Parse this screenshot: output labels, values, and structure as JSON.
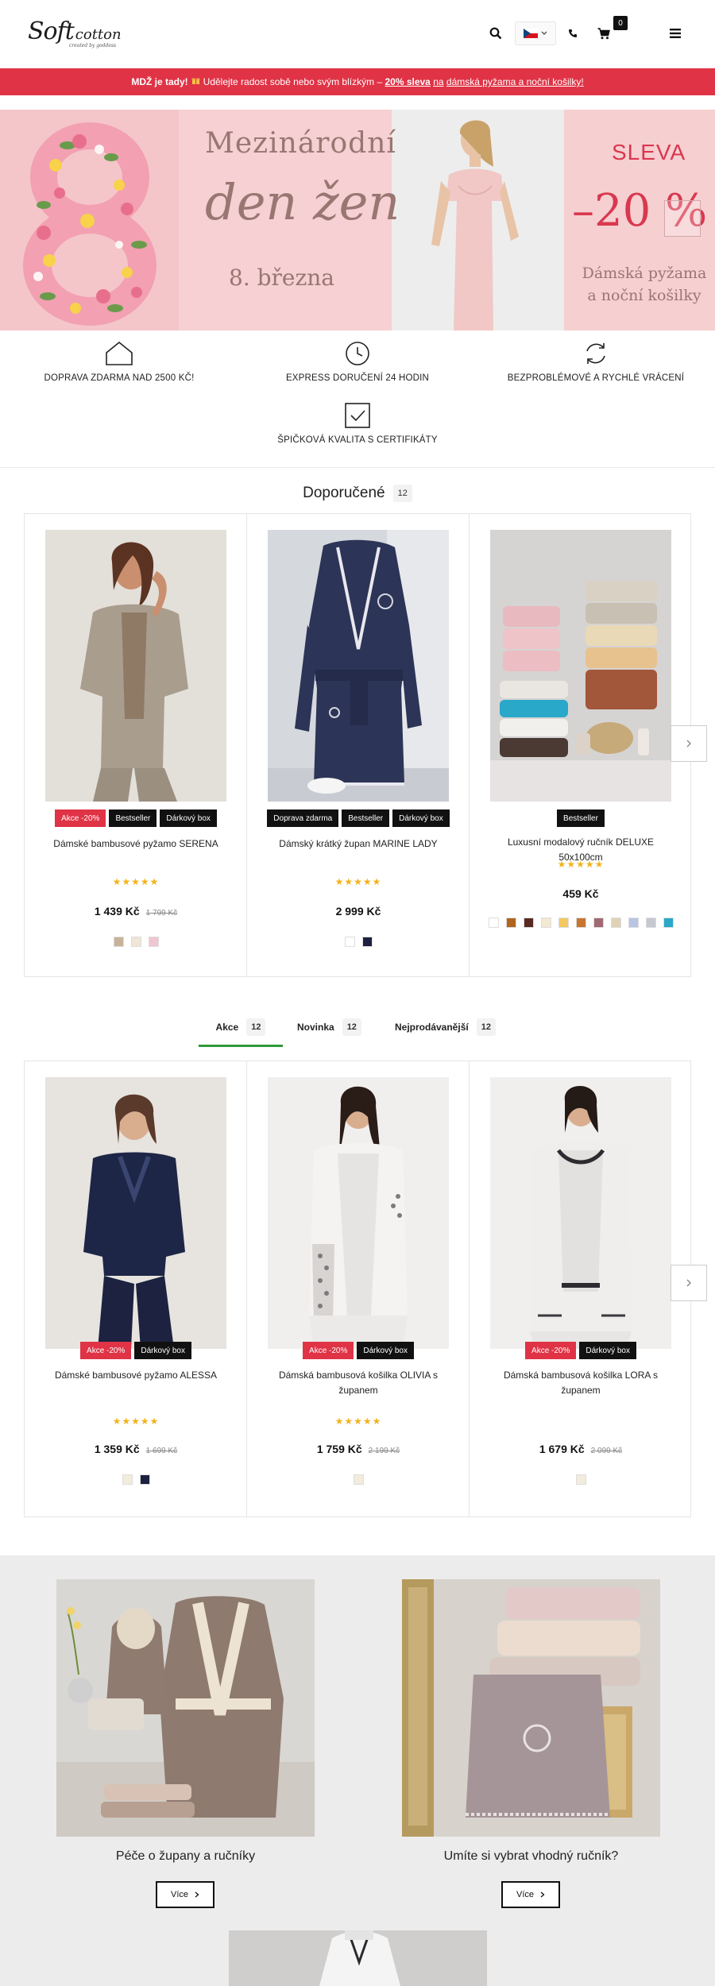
{
  "header": {
    "logo_main": "Soft",
    "logo_second": "cotton",
    "logo_tagline": "created by goddess",
    "cart_count": "0",
    "language": "CZ"
  },
  "promo": {
    "part1": "MDŽ je tady!",
    "part2": "Udělejte radost sobě nebo svým blízkým –",
    "link1": "20% sleva",
    "part3": "na",
    "link2": "dámská pyžama a noční košilky!"
  },
  "hero": {
    "line1": "Mezinárodní",
    "line2": "den žen",
    "line3": "8. března",
    "sale_label": "SLEVA",
    "sale_value": "–20 %",
    "sale_desc1": "Dámská pyžama",
    "sale_desc2": "a noční košilky"
  },
  "features": [
    {
      "label": "DOPRAVA ZDARMA NAD 2500 KČ!",
      "icon": "house-icon"
    },
    {
      "label": "EXPRESS DORUČENÍ 24 HODIN",
      "icon": "clock-icon"
    },
    {
      "label": "BEZPROBLÉMOVÉ A RYCHLÉ VRÁCENÍ",
      "icon": "refresh-icon"
    },
    {
      "label": "ŠPIČKOVÁ KVALITA S CERTIFIKÁTY",
      "icon": "checkbox-icon"
    }
  ],
  "recommended": {
    "title": "Doporučené",
    "count": "12",
    "products": [
      {
        "badges": [
          {
            "text": "Akce -20%",
            "type": "sale"
          },
          {
            "text": "Bestseller",
            "type": "dark"
          },
          {
            "text": "Dárkový box",
            "type": "dark"
          }
        ],
        "name": "Dámské bambusové pyžamo SERENA",
        "stars": "★★★★★",
        "price": "1 439 Kč",
        "old_price": "1 799 Kč",
        "swatches": [
          "#c9b29a",
          "#efe6d8",
          "#efc6d2"
        ]
      },
      {
        "badges": [
          {
            "text": "Doprava zdarma",
            "type": "dark"
          },
          {
            "text": "Bestseller",
            "type": "dark"
          },
          {
            "text": "Dárkový box",
            "type": "dark"
          }
        ],
        "name": "Dámský krátký župan MARINE LADY",
        "stars": "★★★★★",
        "price": "2 999 Kč",
        "old_price": "",
        "swatches": [
          "#ffffff",
          "#1c2140"
        ]
      },
      {
        "badges": [
          {
            "text": "Bestseller",
            "type": "dark"
          }
        ],
        "name": "Luxusní modalový ručník DELUXE 50x100cm",
        "stars": "★★★★★",
        "price": "459 Kč",
        "old_price": "",
        "swatches": [
          "#ffffff",
          "#b0651f",
          "#5a2a22",
          "#f3e9d2",
          "#f4c861",
          "#c6762f",
          "#9f6a72",
          "#e0d2b6",
          "#b7c4e4",
          "#c5c7d1",
          "#29a8c9"
        ]
      }
    ]
  },
  "tabs": [
    {
      "label": "Akce",
      "count": "12"
    },
    {
      "label": "Novinka",
      "count": "12"
    },
    {
      "label": "Nejprodávanější",
      "count": "12"
    }
  ],
  "sale_products": [
    {
      "badges": [
        {
          "text": "Akce -20%",
          "type": "sale"
        },
        {
          "text": "Dárkový box",
          "type": "dark"
        }
      ],
      "name": "Dámské bambusové pyžamo ALESSA",
      "stars": "★★★★★",
      "price": "1 359 Kč",
      "old_price": "1 699 Kč",
      "swatches": [
        "#f2ecdc",
        "#1c2140"
      ]
    },
    {
      "badges": [
        {
          "text": "Akce -20%",
          "type": "sale"
        },
        {
          "text": "Dárkový box",
          "type": "dark"
        }
      ],
      "name": "Dámská bambusová košilka OLIVIA s županem",
      "stars": "★★★★★",
      "price": "1 759 Kč",
      "old_price": "2 199 Kč",
      "swatches": [
        "#f2ecdc"
      ]
    },
    {
      "badges": [
        {
          "text": "Akce -20%",
          "type": "sale"
        },
        {
          "text": "Dárkový box",
          "type": "dark"
        }
      ],
      "name": "Dámská bambusová košilka LORA s županem",
      "stars": "★★★★★",
      "price": "1 679 Kč",
      "old_price": "2 099 Kč",
      "swatches": [
        "#f2ecdc"
      ]
    }
  ],
  "banners": [
    {
      "title": "Péče o župany a ručníky",
      "button": "Více"
    },
    {
      "title": "Umíte si vybrat vhodný ručník?",
      "button": "Více"
    }
  ],
  "colors": {
    "accent_red": "#e03346",
    "tab_active": "#2f9a3a",
    "star": "#f3b21b"
  }
}
